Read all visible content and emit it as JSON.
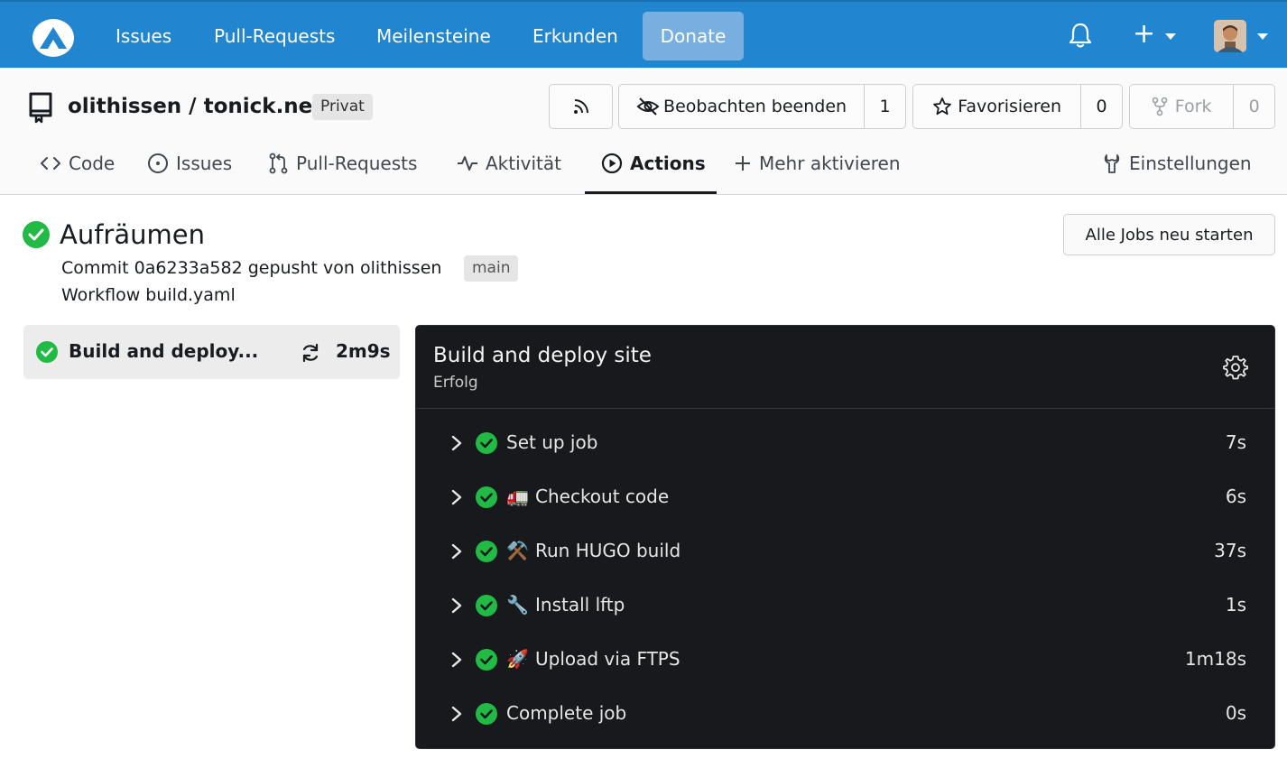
{
  "nav": {
    "links": [
      "Issues",
      "Pull-Requests",
      "Meilensteine",
      "Erkunden"
    ],
    "donate": "Donate",
    "plus": "+"
  },
  "repo": {
    "name": "olithissen / tonick.net",
    "visibility": "Privat",
    "watch_label": "Beobachten beenden",
    "watch_count": "1",
    "star_label": "Favorisieren",
    "star_count": "0",
    "fork_label": "Fork",
    "fork_count": "0"
  },
  "tabs": {
    "code": "Code",
    "issues": "Issues",
    "pulls": "Pull-Requests",
    "activity": "Aktivität",
    "actions": "Actions",
    "more": "Mehr aktivieren",
    "settings": "Einstellungen"
  },
  "run": {
    "title": "Aufräumen",
    "commit_line": "Commit 0a6233a582 gepusht von olithissen",
    "branch": "main",
    "workflow": "Workflow build.yaml",
    "restart_label": "Alle Jobs neu starten"
  },
  "job_list": {
    "name": "Build and deploy...",
    "duration": "2m9s"
  },
  "job": {
    "title": "Build and deploy site",
    "status": "Erfolg",
    "steps": [
      {
        "label": "Set up job",
        "duration": "7s",
        "emoji": ""
      },
      {
        "label": "Checkout code",
        "duration": "6s",
        "emoji": "🚛"
      },
      {
        "label": "Run HUGO build",
        "duration": "37s",
        "emoji": "⚒️"
      },
      {
        "label": "Install lftp",
        "duration": "1s",
        "emoji": "🔧"
      },
      {
        "label": "Upload via FTPS",
        "duration": "1m18s",
        "emoji": "🚀"
      },
      {
        "label": "Complete job",
        "duration": "0s",
        "emoji": ""
      }
    ]
  },
  "colors": {
    "nav_bg": "#2185d0",
    "success": "#21ba45",
    "panel_bg": "#17191c"
  }
}
